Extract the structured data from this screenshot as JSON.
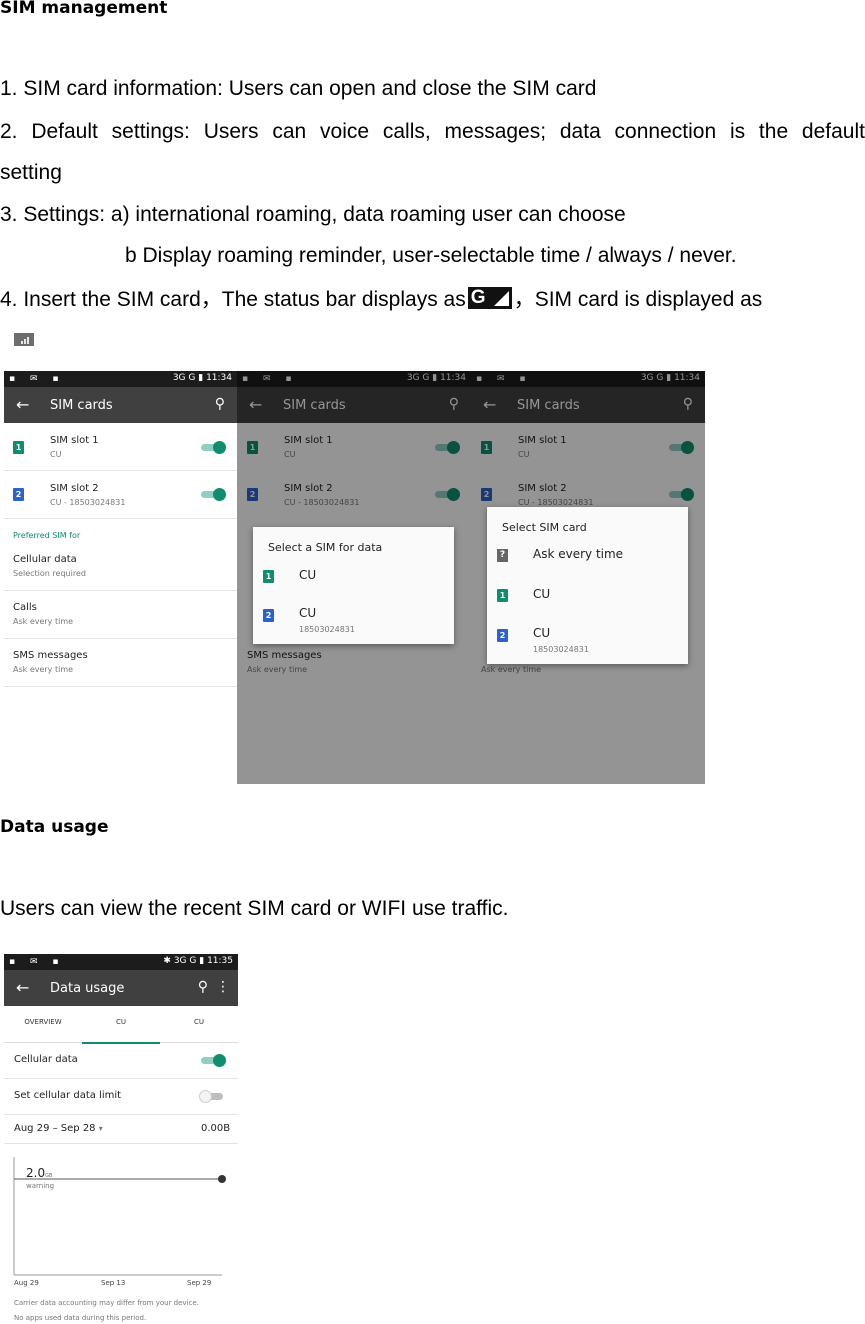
{
  "sim_section": {
    "heading": "SIM management",
    "item1": "1. SIM card information: Users can open and close the SIM card",
    "item2": "2. Default settings: Users can voice calls, messages; data connection is the default",
    "item2_cont": "setting",
    "item3": "3. Settings: a) international roaming, data roaming user can choose",
    "item3b": "b Display roaming reminder, user-selectable time / always / never.",
    "item4_pre": "4. Insert the SIM card，The status bar displays as",
    "item4_icon_letter": "G",
    "item4_post": "，SIM card is displayed as"
  },
  "screens": {
    "status_time_a": "11:34",
    "status_time_b": "11:34",
    "status_time_c": "11:34",
    "status_right": "3G G",
    "title": "SIM cards",
    "slot1_label": "SIM slot 1",
    "slot1_sub": "CU",
    "slot2_label": "SIM slot 2",
    "slot2_sub": "CU - 18503024831",
    "preferred": "Preferred SIM for",
    "cellular_label": "Cellular data",
    "cellular_sub": "Selection required",
    "calls_label": "Calls",
    "calls_sub": "Ask every time",
    "sms_label": "SMS messages",
    "sms_sub": "Ask every time",
    "dialog1_title": "Select a SIM for data",
    "dialog1_opt1": "CU",
    "dialog1_opt2": "CU",
    "dialog1_opt2_sub": "18503024831",
    "dialog2_title": "Select SIM card",
    "dialog2_opt0": "Ask every time",
    "dialog2_opt1": "CU",
    "dialog2_opt2": "CU",
    "dialog2_opt2_sub": "18503024831"
  },
  "data_section": {
    "heading": "Data usage",
    "text": "Users can view the recent SIM card or WIFI use traffic."
  },
  "data_screen": {
    "status_time": "11:35",
    "title": "Data usage",
    "tabs": [
      "OVERVIEW",
      "CU",
      "CU"
    ],
    "cellular_data": "Cellular data",
    "set_limit": "Set cellular data limit",
    "range": "Aug 29 – Sep 28",
    "amount": "0.00B",
    "warning_value": "2.0",
    "warning_unit": "GB",
    "warning_label": "warning",
    "x_ticks": [
      "Aug 29",
      "Sep 13",
      "Sep 29"
    ],
    "note1": "Carrier data accounting may differ from your device.",
    "note2": "No apps used data during this period."
  }
}
